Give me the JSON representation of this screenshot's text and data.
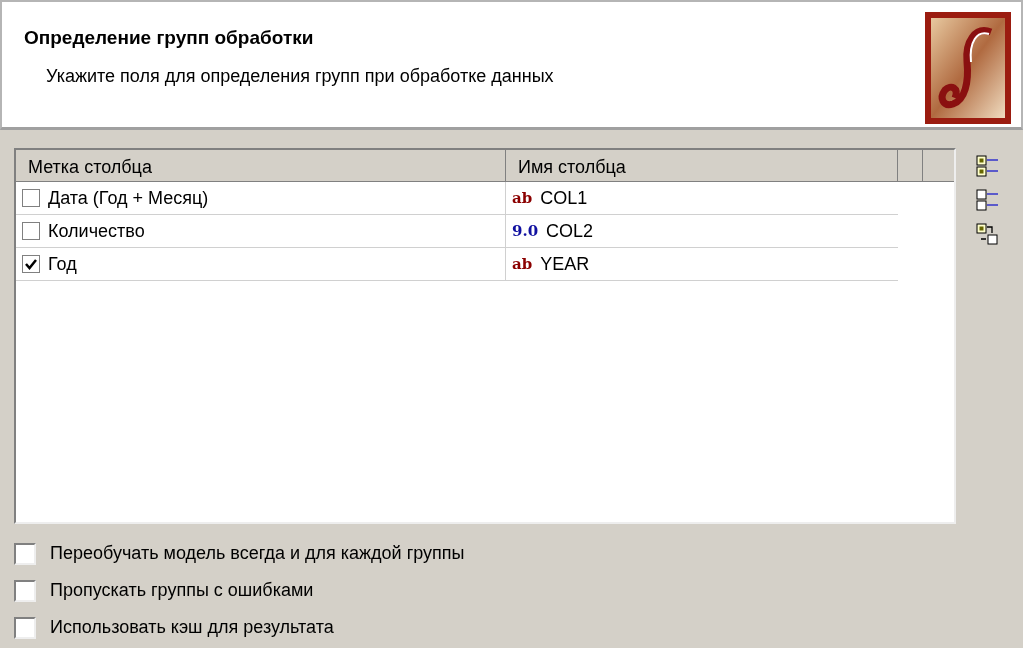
{
  "header": {
    "title": "Определение групп обработки",
    "subtitle": "Укажите поля для определения  групп при обработке данных"
  },
  "table": {
    "columns": [
      "Метка столбца",
      "Имя столбца"
    ],
    "rows": [
      {
        "label": "Дата (Год + Месяц)",
        "checked": false,
        "kind": "text",
        "type_badge": "ab",
        "name": "COL1"
      },
      {
        "label": "Количество",
        "checked": false,
        "kind": "number",
        "type_badge": "9.0",
        "name": "COL2"
      },
      {
        "label": "Год",
        "checked": true,
        "kind": "text",
        "type_badge": "ab",
        "name": "YEAR"
      }
    ]
  },
  "toolbar": [
    {
      "kind": "select-all"
    },
    {
      "kind": "deselect-all"
    },
    {
      "kind": "invert"
    }
  ],
  "options": [
    {
      "label": "Переобучать модель всегда и для каждой группы",
      "checked": false
    },
    {
      "label": "Пропускать группы с ошибками",
      "checked": false
    },
    {
      "label": "Использовать кэш для результата",
      "checked": false
    }
  ]
}
